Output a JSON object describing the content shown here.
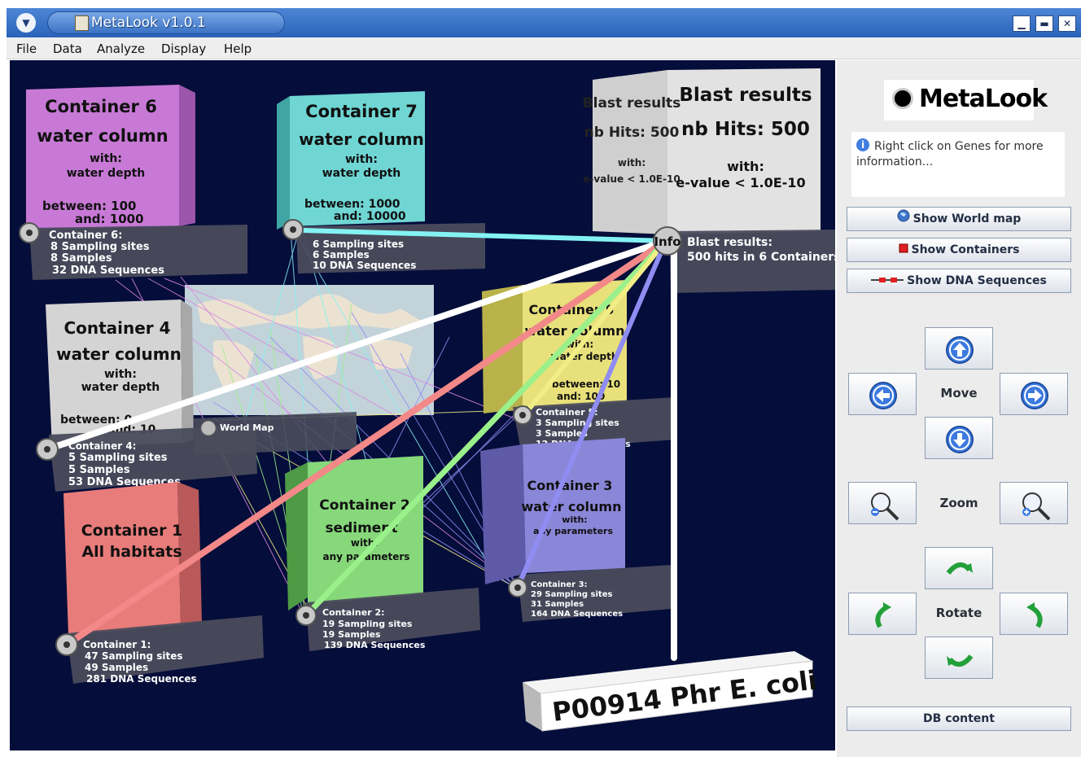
{
  "window": {
    "title": "MetaLook v1.0.1",
    "controls": [
      "minimize",
      "maximize",
      "close"
    ]
  },
  "menu": [
    "File",
    "Data",
    "Analyze",
    "Display",
    "Help"
  ],
  "scene": {
    "containers": [
      {
        "id": "container6",
        "face_title": "Container 6",
        "face_subtitle": "water column",
        "face_with": "with:",
        "face_param": "water depth",
        "face_range1": "between: 100",
        "face_range2": "and: 1000",
        "tag_title": "Container 6:",
        "tag_line1": "8 Sampling sites",
        "tag_line2": "8 Samples",
        "tag_line3": "32 DNA Sequences",
        "color": "#c879d6"
      },
      {
        "id": "container7",
        "face_title": "Container 7",
        "face_subtitle": "water column",
        "face_with": "with:",
        "face_param": "water depth",
        "face_range1": "between: 1000",
        "face_range2": "and: 10000",
        "tag_line1": "6 Sampling sites",
        "tag_line2": "6 Samples",
        "tag_line3": "10 DNA Sequences",
        "color": "#6fd6d4"
      },
      {
        "id": "container4",
        "face_title": "Container 4",
        "face_subtitle": "water column",
        "face_with": "with:",
        "face_param": "water depth",
        "face_range1": "between: 0",
        "face_range2": "and: 10",
        "tag_title": "Container 4:",
        "tag_line1": "5 Sampling sites",
        "tag_line2": "5 Samples",
        "tag_line3": "53 DNA Sequences",
        "color": "#d4d4d4"
      },
      {
        "id": "container5",
        "face_title": "Container 5",
        "face_subtitle": "water column",
        "face_with": "with:",
        "face_param": "water depth",
        "face_range1": "between: 10",
        "face_range2": "and: 100",
        "tag_title": "Container 5:",
        "tag_line1": "3 Sampling sites",
        "tag_line2": "3 Samples",
        "tag_line3": "12 DNA Sequences",
        "color": "#e8e07a"
      },
      {
        "id": "container1",
        "face_title": "Container 1",
        "face_subtitle": "All habitats",
        "tag_title": "Container 1:",
        "tag_line1": "47 Sampling sites",
        "tag_line2": "49 Samples",
        "tag_line3": "281 DNA Sequences",
        "color": "#e87c7a"
      },
      {
        "id": "container2",
        "face_title": "Container 2",
        "face_subtitle": "sediment",
        "face_with": "with:",
        "face_param": "any parameters",
        "tag_title": "Container 2:",
        "tag_line1": "19 Sampling sites",
        "tag_line2": "19 Samples",
        "tag_line3": "139 DNA Sequences",
        "color": "#86d87a"
      },
      {
        "id": "container3",
        "face_title": "Container 3",
        "face_subtitle": "water column",
        "face_with": "with:",
        "face_param": "any parameters",
        "tag_title": "Container 3:",
        "tag_line1": "29 Sampling sites",
        "tag_line2": "31 Samples",
        "tag_line3": "164 DNA Sequences",
        "color": "#8a86d8"
      }
    ],
    "blast": {
      "side_line1": "Blast results",
      "side_line2": "nb Hits: 500",
      "side_line3": "with:",
      "side_line4": "e-value < 1.0E-10",
      "face_line1": "Blast results",
      "face_line2": "nb Hits: 500",
      "face_line3": "with:",
      "face_line4": "e-value < 1.0E-10",
      "tag_line1": "Blast results:",
      "tag_line2": "500 hits in 6 Containers"
    },
    "world_map_tag": "World Map",
    "gene_label": "P00914 Phr E. coli",
    "info_badge": "Info",
    "colors": {
      "background": "#050d3a",
      "link_c6": "#d887e4",
      "link_c7": "#84f2f2",
      "link_c4": "#ffffff",
      "link_c5": "#f2ee86",
      "link_c1": "#f28888",
      "link_c2": "#9af08a",
      "link_c3": "#8f8cf2"
    }
  },
  "sidepanel": {
    "logo": "MetaLook",
    "info_text": "Right click on Genes for more information...",
    "buttons": {
      "world_map": "Show World map",
      "containers": "Show Containers",
      "dna": "Show DNA Sequences",
      "db": "DB content"
    },
    "labels": {
      "move": "Move",
      "zoom": "Zoom",
      "rotate": "Rotate"
    }
  }
}
